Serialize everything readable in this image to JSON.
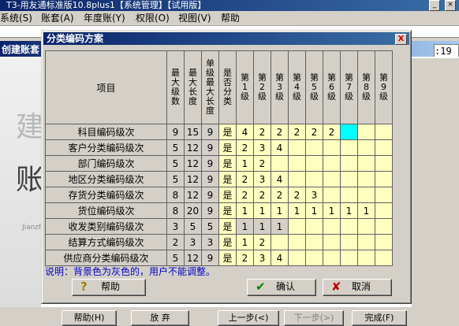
{
  "app": {
    "title": "T3-用友通标准版10.8plus1【系统管理】【试用版】",
    "menu": [
      "系统(S)",
      "账套(A)",
      "年度账(Y)",
      "权限(O)",
      "视图(V)",
      "帮助"
    ],
    "window_title": "创建账套",
    "time": ":19",
    "art_big": [
      "建",
      "账"
    ],
    "art_small": "Jianzhang",
    "buttons": {
      "help": "帮助(H)",
      "discard": "放 弃",
      "prev": "上一步(<)",
      "next": "下一步(>)",
      "finish": "完成(F)"
    }
  },
  "dialog": {
    "title": "分类编码方案",
    "close": "X",
    "headers": {
      "item": "项目",
      "max_levels": "最大级数",
      "max_length": "最大长度",
      "max_level_length": "单级最大长度",
      "is_classified": "是否分类",
      "levels": [
        "第1级",
        "第2级",
        "第3级",
        "第4级",
        "第5级",
        "第6级",
        "第7级",
        "第8级",
        "第9级"
      ]
    },
    "rows": [
      {
        "name": "科目编码级次",
        "max_levels": "9",
        "max_length": "15",
        "level_max": "9",
        "classified": "是",
        "levels": [
          "4",
          "2",
          "2",
          "2",
          "2",
          "2",
          "",
          "",
          ""
        ]
      },
      {
        "name": "客户分类编码级次",
        "max_levels": "5",
        "max_length": "12",
        "level_max": "9",
        "classified": "是",
        "levels": [
          "2",
          "3",
          "4",
          "",
          "",
          "",
          "",
          "",
          ""
        ]
      },
      {
        "name": "部门编码级次",
        "max_levels": "5",
        "max_length": "12",
        "level_max": "9",
        "classified": "是",
        "levels": [
          "1",
          "2",
          "",
          "",
          "",
          "",
          "",
          "",
          ""
        ]
      },
      {
        "name": "地区分类编码级次",
        "max_levels": "5",
        "max_length": "12",
        "level_max": "9",
        "classified": "是",
        "levels": [
          "2",
          "3",
          "4",
          "",
          "",
          "",
          "",
          "",
          ""
        ]
      },
      {
        "name": "存货分类编码级次",
        "max_levels": "8",
        "max_length": "12",
        "level_max": "9",
        "classified": "是",
        "levels": [
          "2",
          "2",
          "2",
          "2",
          "3",
          "",
          "",
          "",
          ""
        ]
      },
      {
        "name": "货位编码级次",
        "max_levels": "8",
        "max_length": "20",
        "level_max": "9",
        "classified": "是",
        "levels": [
          "1",
          "1",
          "1",
          "1",
          "1",
          "1",
          "1",
          "1",
          ""
        ]
      },
      {
        "name": "收发类别编码级次",
        "max_levels": "3",
        "max_length": "5",
        "level_max": "5",
        "classified": "是",
        "levels": [
          "1",
          "1",
          "1",
          "",
          "",
          "",
          "",
          "",
          ""
        ]
      },
      {
        "name": "结算方式编码级次",
        "max_levels": "2",
        "max_length": "3",
        "level_max": "3",
        "classified": "是",
        "levels": [
          "1",
          "2",
          "",
          "",
          "",
          "",
          "",
          "",
          ""
        ]
      },
      {
        "name": "供应商分类编码级次",
        "max_levels": "5",
        "max_length": "12",
        "level_max": "9",
        "classified": "是",
        "levels": [
          "2",
          "3",
          "4",
          "",
          "",
          "",
          "",
          "",
          ""
        ]
      }
    ],
    "note": "说明：背景色为灰色的，用户不能调整。",
    "buttons": {
      "help": "帮助",
      "confirm": "确认",
      "cancel": "取消"
    },
    "colors": {
      "editable": "#ffffc0",
      "locked": "#d4d0c8",
      "selected": "#00ffff"
    }
  }
}
